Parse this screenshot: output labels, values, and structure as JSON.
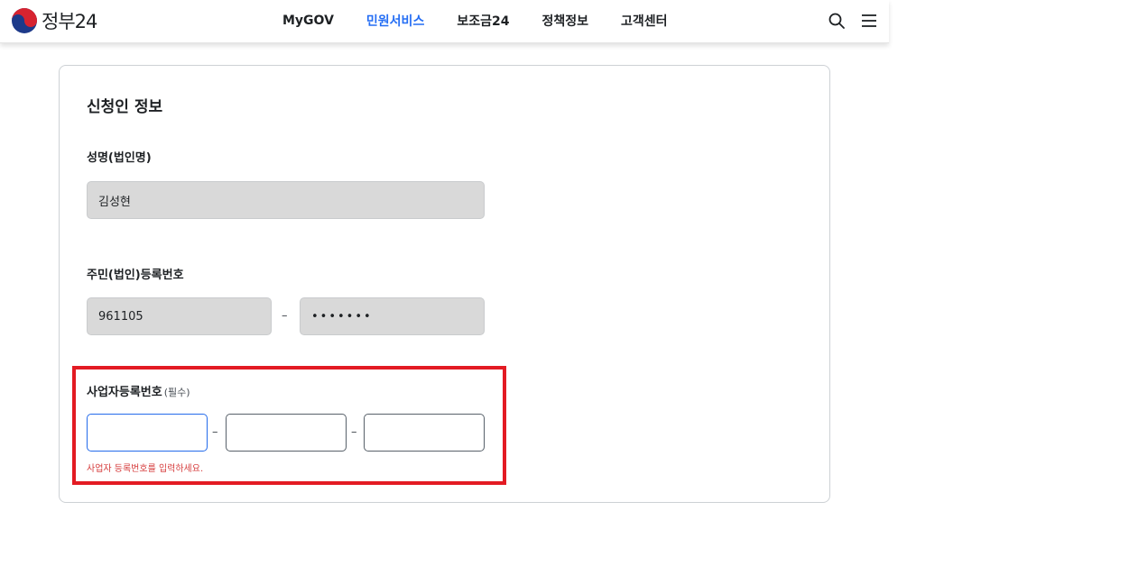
{
  "header": {
    "logo_text": "정부24",
    "nav": [
      {
        "label": "MyGOV",
        "active": false
      },
      {
        "label": "민원서비스",
        "active": true
      },
      {
        "label": "보조금24",
        "active": false
      },
      {
        "label": "정책정보",
        "active": false
      },
      {
        "label": "고객센터",
        "active": false
      }
    ],
    "icons": [
      "search-icon",
      "hamburger-menu-icon"
    ]
  },
  "form": {
    "title": "신청인 정보",
    "name_label": "성명(법인명)",
    "name_value": "김성현",
    "rrn_label": "주민(법인)등록번호",
    "rrn_front": "961105",
    "rrn_separator": "–",
    "rrn_back_masked": "•••••••",
    "brn_label": "사업자등록번호",
    "brn_required": "(필수)",
    "brn_separator": "–",
    "brn_parts": [
      "",
      "",
      ""
    ],
    "brn_error": "사업자 등록번호를 입력하세요."
  },
  "colors": {
    "accent": "#256ef4",
    "highlight_border": "#e31b23",
    "error_text": "#d63d3d",
    "readonly_bg": "#d9d9d9"
  }
}
